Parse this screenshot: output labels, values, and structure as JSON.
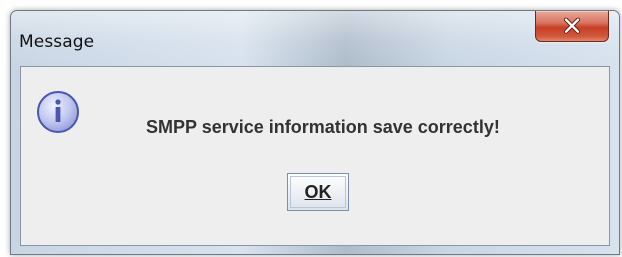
{
  "window": {
    "title": "Message"
  },
  "titlebar": {
    "close_icon": "close-icon"
  },
  "dialog": {
    "icon": "info-icon",
    "message": "SMPP service information save correctly!",
    "ok_label": "OK"
  },
  "colors": {
    "close_button": "#c53f25",
    "content_background": "#eeeeee",
    "info_icon_fill": "#b7bfe9",
    "info_icon_border": "#4b56b0"
  }
}
